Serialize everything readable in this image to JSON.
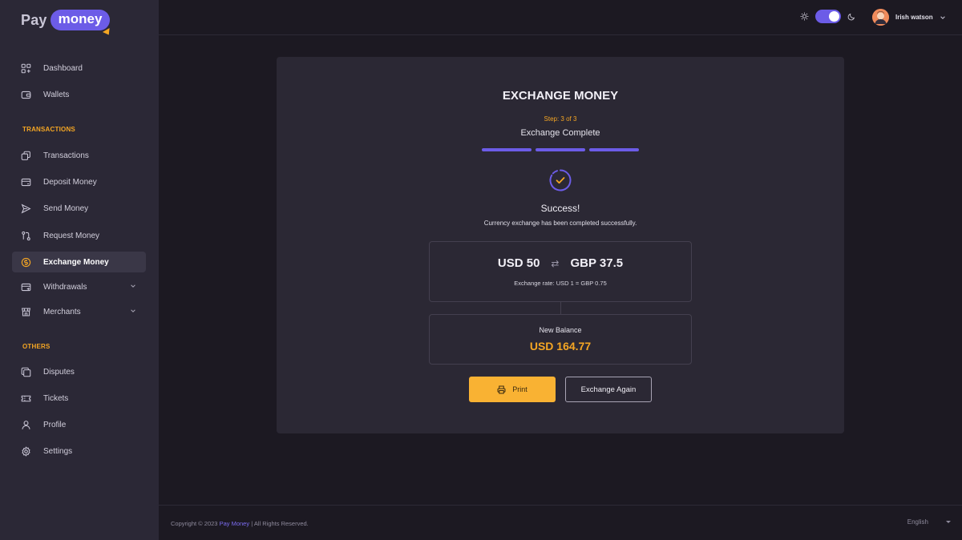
{
  "brand": {
    "pay": "Pay",
    "money": "money"
  },
  "sidebar": {
    "items": [
      {
        "label": "Dashboard",
        "icon": "dashboard-icon"
      },
      {
        "label": "Wallets",
        "icon": "wallet-icon"
      }
    ],
    "transactions_heading": "TRANSACTIONS",
    "transaction_items": [
      {
        "label": "Transactions",
        "icon": "transactions-icon"
      },
      {
        "label": "Deposit Money",
        "icon": "deposit-icon"
      },
      {
        "label": "Send Money",
        "icon": "send-icon"
      },
      {
        "label": "Request Money",
        "icon": "request-icon"
      },
      {
        "label": "Exchange Money",
        "icon": "exchange-icon",
        "active": true
      },
      {
        "label": "Withdrawals",
        "icon": "withdrawal-icon",
        "has_submenu": true
      },
      {
        "label": "Merchants",
        "icon": "merchant-icon",
        "has_submenu": true
      }
    ],
    "others_heading": "OTHERS",
    "other_items": [
      {
        "label": "Disputes",
        "icon": "disputes-icon"
      },
      {
        "label": "Tickets",
        "icon": "ticket-icon"
      },
      {
        "label": "Profile",
        "icon": "profile-icon"
      },
      {
        "label": "Settings",
        "icon": "gear-icon"
      }
    ]
  },
  "header": {
    "user_name": "Irish watson",
    "theme_dark": true
  },
  "exchange": {
    "title": "EXCHANGE MONEY",
    "step_label": "Step: 3 of 3",
    "step_name": "Exchange Complete",
    "progress_steps": 3,
    "progress_completed": 3,
    "success_title": "Success!",
    "success_message": "Currency exchange has been completed successfully.",
    "from_amount": "USD 50",
    "to_amount": "GBP 37.5",
    "rate": "Exchange rate: USD 1 = GBP 0.75",
    "balance_label": "New Balance",
    "balance_value": "USD 164.77",
    "print_label": "Print",
    "again_label": "Exchange Again"
  },
  "footer": {
    "copyright_prefix": "Copyright © 2023",
    "copyright_brand": "Pay Money",
    "copyright_suffix": "| All Rights Reserved.",
    "language": "English"
  },
  "colors": {
    "accent": "#6c5ce7",
    "highlight": "#f5a623",
    "background": "#1c1922",
    "sidebar": "#2b2836"
  }
}
